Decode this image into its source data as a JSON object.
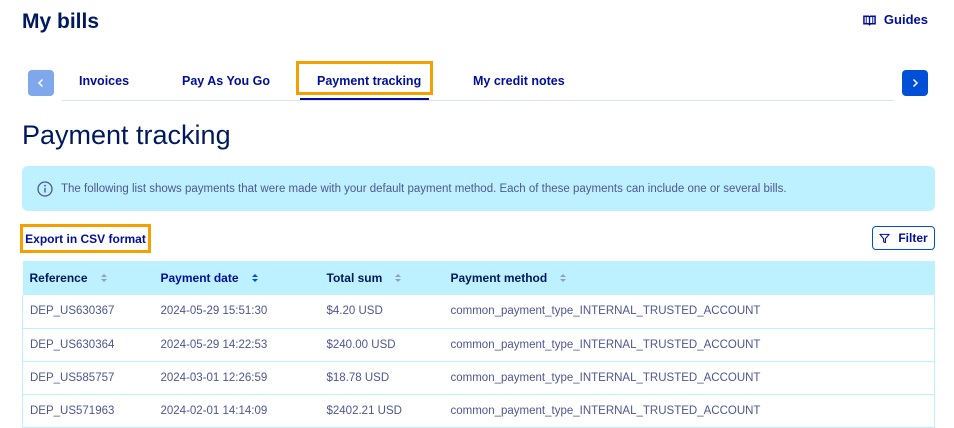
{
  "header": {
    "title": "My bills",
    "guides_label": "Guides"
  },
  "tabs": [
    {
      "label": "Invoices",
      "active": false
    },
    {
      "label": "Pay As You Go",
      "active": false
    },
    {
      "label": "Payment tracking",
      "active": true
    },
    {
      "label": "My credit notes",
      "active": false
    }
  ],
  "section": {
    "title": "Payment tracking",
    "info_text": "The following list shows payments that were made with your default payment method. Each of these payments can include one or several bills."
  },
  "actions": {
    "export_label": "Export in CSV format",
    "filter_label": "Filter"
  },
  "table": {
    "columns": [
      "Reference",
      "Payment date",
      "Total sum",
      "Payment method"
    ],
    "rows": [
      [
        "DEP_US630367",
        "2024-05-29 15:51:30",
        "$4.20 USD",
        "common_payment_type_INTERNAL_TRUSTED_ACCOUNT"
      ],
      [
        "DEP_US630364",
        "2024-05-29 14:22:53",
        "$240.00 USD",
        "common_payment_type_INTERNAL_TRUSTED_ACCOUNT"
      ],
      [
        "DEP_US585757",
        "2024-03-01 12:26:59",
        "$18.78 USD",
        "common_payment_type_INTERNAL_TRUSTED_ACCOUNT"
      ],
      [
        "DEP_US571963",
        "2024-02-01 14:14:09",
        "$2402.21 USD",
        "common_payment_type_INTERNAL_TRUSTED_ACCOUNT"
      ]
    ]
  },
  "colors": {
    "primary": "#000e9c",
    "accent_blue": "#0050d7",
    "highlight": "#f59f00",
    "info_bg": "#bef1ff"
  },
  "icons": {
    "guides": "book-icon",
    "prev": "chevron-left-icon",
    "next": "chevron-right-icon",
    "info": "info-icon",
    "filter": "filter-icon",
    "sort": "sort-icon"
  }
}
